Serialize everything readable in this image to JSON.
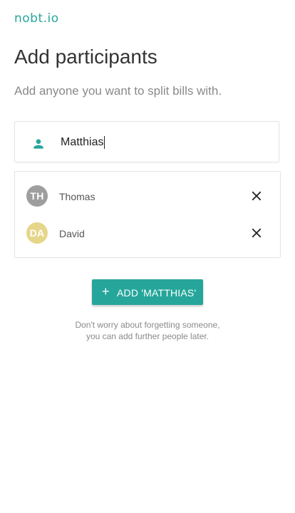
{
  "app": {
    "logo": "nobt.io",
    "accent_color": "#26a69a"
  },
  "page": {
    "title": "Add participants",
    "subtitle": "Add anyone you want to split bills with."
  },
  "participant_input": {
    "icon": "person-icon",
    "value": "Matthias"
  },
  "participants": [
    {
      "initials": "TH",
      "name": "Thomas",
      "avatar_color": "#9e9e9e",
      "remove_icon": "close-icon"
    },
    {
      "initials": "DA",
      "name": "David",
      "avatar_color": "#e6d68a",
      "remove_icon": "close-icon"
    }
  ],
  "add_button": {
    "icon": "plus-icon",
    "label": "Add 'Matthias'"
  },
  "hint": {
    "line1": "Don't worry about forgetting someone,",
    "line2": "you can add further people later."
  }
}
